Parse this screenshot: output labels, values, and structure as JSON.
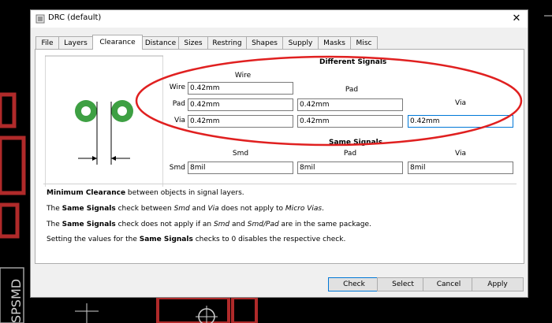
{
  "window": {
    "title": "DRC (default)",
    "close_glyph": "✕"
  },
  "tabs": [
    {
      "label": "File"
    },
    {
      "label": "Layers"
    },
    {
      "label": "Clearance"
    },
    {
      "label": "Distance"
    },
    {
      "label": "Sizes"
    },
    {
      "label": "Restring"
    },
    {
      "label": "Shapes"
    },
    {
      "label": "Supply"
    },
    {
      "label": "Masks"
    },
    {
      "label": "Misc"
    }
  ],
  "active_tab": "Clearance",
  "different_signals": {
    "heading": "Different Signals",
    "col_wire": "Wire",
    "col_pad": "Pad",
    "col_via": "Via",
    "rows": [
      {
        "label": "Wire",
        "values": [
          "0.42mm"
        ]
      },
      {
        "label": "Pad",
        "values": [
          "0.42mm",
          "0.42mm"
        ]
      },
      {
        "label": "Via",
        "values": [
          "0.42mm",
          "0.42mm",
          "0.42mm"
        ]
      }
    ]
  },
  "same_signals": {
    "heading": "Same Signals",
    "col_smd": "Smd",
    "col_pad": "Pad",
    "col_via": "Via",
    "row_label": "Smd",
    "values": [
      "8mil",
      "8mil",
      "8mil"
    ]
  },
  "info": {
    "line1_bold": "Minimum Clearance",
    "line1_rest": " between objects in signal layers.",
    "line2_a": "The ",
    "line2_b": "Same Signals",
    "line2_c": " check between ",
    "line2_d": "Smd",
    "line2_e": " and ",
    "line2_f": "Via",
    "line2_g": " does not apply to ",
    "line2_h": "Micro Vias",
    "line2_i": ".",
    "line3_a": "The ",
    "line3_b": "Same Signals",
    "line3_c": " check does not apply if an ",
    "line3_d": "Smd",
    "line3_e": " and ",
    "line3_f": "Smd/Pad",
    "line3_g": " are in the same package.",
    "line4_a": "Setting the values for the ",
    "line4_b": "Same Signals",
    "line4_c": " checks to 0 disables the respective check."
  },
  "buttons": {
    "check": "Check",
    "select": "Select",
    "cancel": "Cancel",
    "apply": "Apply"
  },
  "colors": {
    "pad_green": "#3ea043",
    "highlight_red": "#e02020",
    "pcb_trace": "#b02a2a"
  }
}
